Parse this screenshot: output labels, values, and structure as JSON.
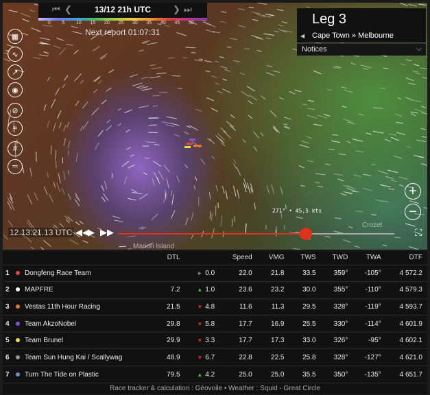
{
  "timebar": {
    "date": "13/12 21h UTC",
    "first": "⏮",
    "prev": "❮",
    "next": "❯",
    "last": "⏭"
  },
  "scale_ticks": [
    "0",
    "5",
    "10",
    "15",
    "20",
    "25",
    "30",
    "35",
    "40",
    "45",
    "50"
  ],
  "next_report": "Next report 01:07:31",
  "leg": {
    "title": "Leg 3",
    "route": "Cape Town » Melbourne",
    "notices": "Notices"
  },
  "map": {
    "wind_readout": "271° • 45,5 kts",
    "place_marion": "Marion Island",
    "place_crozet": "Crozet"
  },
  "playback": {
    "time": "12.13.21.13 UTC",
    "progress": 0.68
  },
  "columns": [
    "DTL",
    "Speed",
    "VMG",
    "TWS",
    "TWD",
    "TWA",
    "DTF"
  ],
  "colors": {
    "up": "#5cbb3a",
    "down": "#e0301e",
    "flat": "#888888",
    "track": "#e0301e"
  },
  "rows": [
    {
      "pos": "1",
      "color": "#e24a3a",
      "team": "Dongfeng Race Team",
      "dtl": "",
      "dir": "flat",
      "delta": "0.0",
      "speed": "22.0",
      "vmg": "21.8",
      "tws": "33.5",
      "twd": "359°",
      "twa": "-105°",
      "dtf": "4 572.2"
    },
    {
      "pos": "2",
      "color": "#ffffff",
      "team": "MAPFRE",
      "dtl": "7.2",
      "dir": "up",
      "delta": "1.0",
      "speed": "23.6",
      "vmg": "23.2",
      "tws": "30.0",
      "twd": "355°",
      "twa": "-110°",
      "dtf": "4 579.3"
    },
    {
      "pos": "3",
      "color": "#e8772a",
      "team": "Vestas 11th Hour Racing",
      "dtl": "21.5",
      "dir": "down",
      "delta": "4.8",
      "speed": "11.6",
      "vmg": "11.3",
      "tws": "29.5",
      "twd": "328°",
      "twa": "-119°",
      "dtf": "4 593.7"
    },
    {
      "pos": "4",
      "color": "#8a4fd6",
      "team": "Team AkzoNobel",
      "dtl": "29.8",
      "dir": "down",
      "delta": "5.8",
      "speed": "17.7",
      "vmg": "16.9",
      "tws": "25.5",
      "twd": "330°",
      "twa": "-114°",
      "dtf": "4 601.9"
    },
    {
      "pos": "5",
      "color": "#f2e23a",
      "team": "Team Brunel",
      "dtl": "29.9",
      "dir": "down",
      "delta": "3.3",
      "speed": "17.7",
      "vmg": "17.3",
      "tws": "33.0",
      "twd": "326°",
      "twa": "-95°",
      "dtf": "4 602.1"
    },
    {
      "pos": "6",
      "color": "#9a9a9a",
      "team": "Team Sun Hung Kai / Scallywag",
      "dtl": "48.9",
      "dir": "down",
      "delta": "6.7",
      "speed": "22.8",
      "vmg": "22.5",
      "tws": "25.8",
      "twd": "328°",
      "twa": "-127°",
      "dtf": "4 621.0"
    },
    {
      "pos": "7",
      "color": "#6f8fc8",
      "team": "Turn The Tide on Plastic",
      "dtl": "79.5",
      "dir": "up",
      "delta": "4.2",
      "speed": "25.0",
      "vmg": "25.0",
      "tws": "35.5",
      "twd": "350°",
      "twa": "-135°",
      "dtf": "4 651.7"
    }
  ],
  "footer": "Race tracker & calculation : Géovoile • Weather : Squid - Great Circle"
}
